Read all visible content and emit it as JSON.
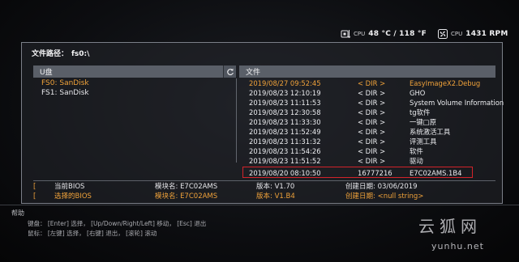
{
  "status": {
    "temp_label": "CPU",
    "temp_value": "48 °C / 118 °F",
    "fan_label": "CPU",
    "fan_value": "1431 RPM"
  },
  "path": {
    "label": "文件路径：",
    "value": "fs0:\\"
  },
  "drives": {
    "header": "U盘",
    "items": [
      {
        "label": "FS0: SanDisk",
        "active": true
      },
      {
        "label": "FS1: SanDisk",
        "active": false
      }
    ]
  },
  "files": {
    "header": "文件",
    "rows": [
      {
        "date": "2019/08/27 09:52:45",
        "type": "< DIR >",
        "name": "EasyImageX2.Debug",
        "active": true
      },
      {
        "date": "2019/08/23 12:10:19",
        "type": "< DIR >",
        "name": "GHO"
      },
      {
        "date": "2019/08/23 11:11:53",
        "type": "< DIR >",
        "name": "System Volume Information"
      },
      {
        "date": "2019/08/23 12:30:58",
        "type": "< DIR >",
        "name": "tg软件"
      },
      {
        "date": "2019/08/23 11:33:30",
        "type": "< DIR >",
        "name": "一键□原"
      },
      {
        "date": "2019/08/23 11:52:49",
        "type": "< DIR >",
        "name": "系统激活工具"
      },
      {
        "date": "2019/08/23 11:31:32",
        "type": "< DIR >",
        "name": "评测工具"
      },
      {
        "date": "2019/08/23 11:54:26",
        "type": "< DIR >",
        "name": "软件"
      },
      {
        "date": "2019/08/23 11:51:52",
        "type": "< DIR >",
        "name": "驱动"
      },
      {
        "date": "2019/08/20 08:10:50",
        "type": "16777216",
        "name": "E7C02AMS.1B4",
        "selected": true
      }
    ]
  },
  "bios_info": {
    "current": {
      "title": "当前BIOS",
      "model_label": "模块名: E7C02AMS",
      "version_label": "版本: V1.70",
      "created_label": "创建日期: 03/06/2019"
    },
    "selected": {
      "title": "选择的BIOS",
      "model_label": "模块名: E7C02AMS",
      "version_label": "版本: V1.B4",
      "created_label": "创建日期: <null string>"
    }
  },
  "help": {
    "title": "帮助",
    "keyboard": "键盘： [Enter] 选择，  [Up/Down/Right/Left] 移动，  [Esc] 退出",
    "mouse": "鼠标： [左键] 选择，  [右键] 退出，  [滚轮] 滚动"
  },
  "watermark": {
    "title": "云狐网",
    "url": "yunhu.net"
  },
  "colors": {
    "accent": "#f0a23a",
    "selection_border": "#d2232a",
    "header_bg": "#5a5f68"
  },
  "icons": {
    "temp": "thermometer-chip-icon",
    "fan": "fan-icon",
    "refresh": "refresh-icon"
  }
}
